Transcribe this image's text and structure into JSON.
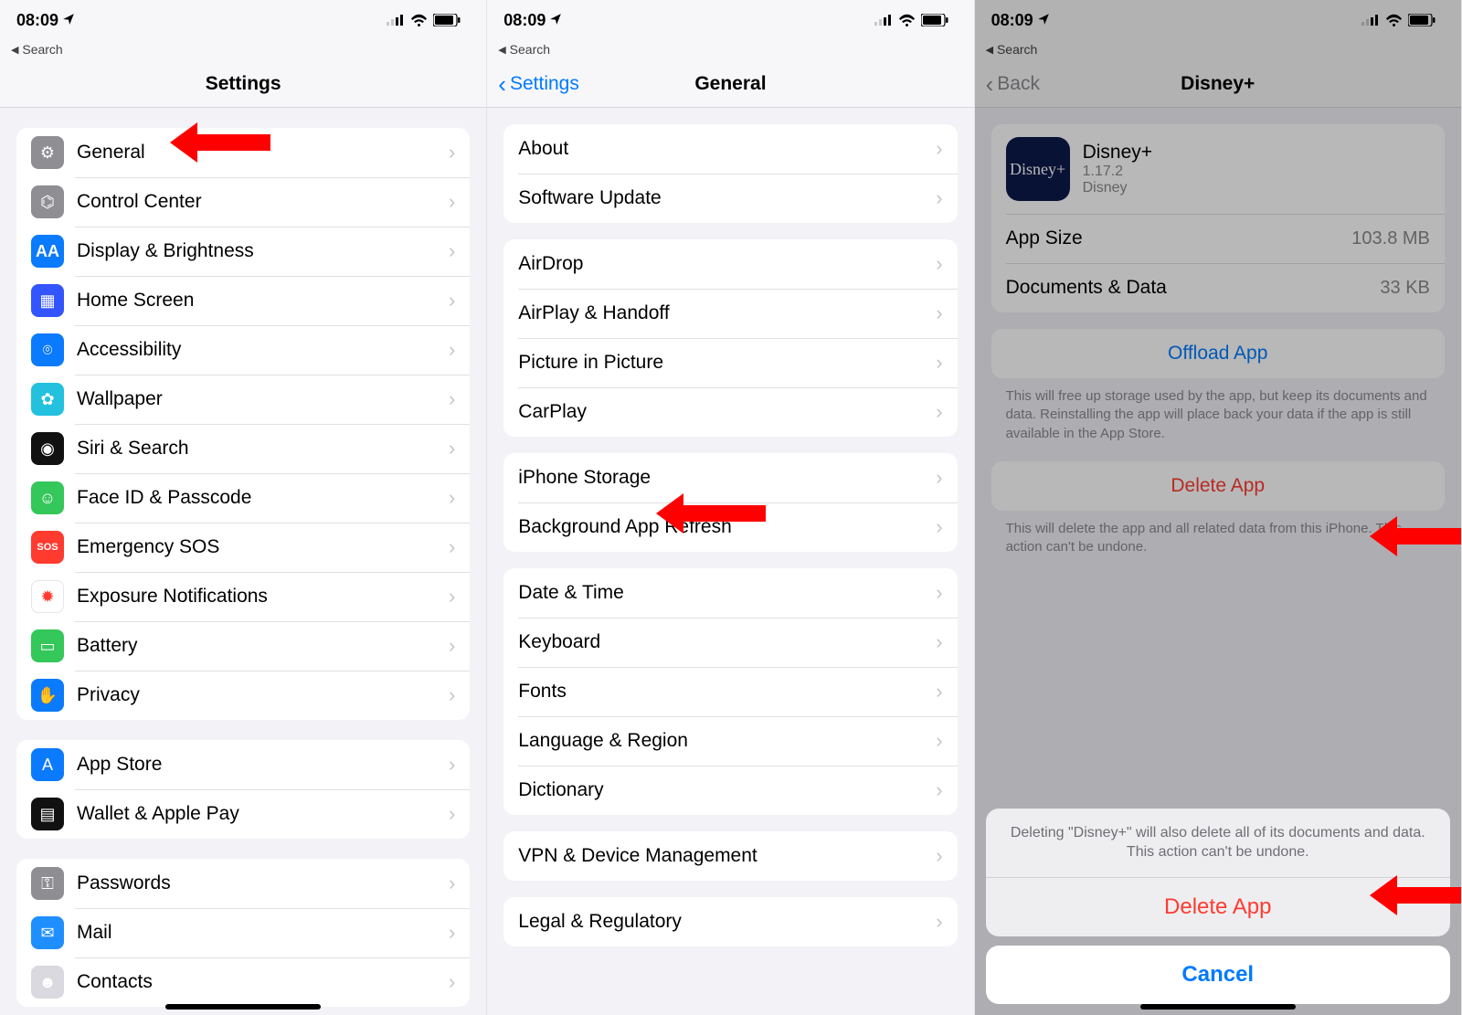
{
  "status": {
    "time": "08:09",
    "breadcrumb": "Search"
  },
  "screen1": {
    "title": "Settings",
    "groups": [
      [
        {
          "label": "General",
          "icon": "gear-icon",
          "bg": "#8e8e93"
        },
        {
          "label": "Control Center",
          "icon": "switches-icon",
          "bg": "#8e8e93"
        },
        {
          "label": "Display & Brightness",
          "icon": "text-size-icon",
          "bg": "#0a7aff"
        },
        {
          "label": "Home Screen",
          "icon": "grid-icon",
          "bg": "#3355ff"
        },
        {
          "label": "Accessibility",
          "icon": "person-icon",
          "bg": "#0a7aff"
        },
        {
          "label": "Wallpaper",
          "icon": "flower-icon",
          "bg": "#23c1de"
        },
        {
          "label": "Siri & Search",
          "icon": "siri-icon",
          "bg": "#111"
        },
        {
          "label": "Face ID & Passcode",
          "icon": "faceid-icon",
          "bg": "#34c759"
        },
        {
          "label": "Emergency SOS",
          "icon": "sos-icon",
          "bg": "#ff3b30"
        },
        {
          "label": "Exposure Notifications",
          "icon": "exposure-icon",
          "bg": "#fff",
          "fg": "#ff3b30",
          "border": true
        },
        {
          "label": "Battery",
          "icon": "battery-icon",
          "bg": "#34c759"
        },
        {
          "label": "Privacy",
          "icon": "hand-icon",
          "bg": "#0a7aff"
        }
      ],
      [
        {
          "label": "App Store",
          "icon": "appstore-icon",
          "bg": "#0a7aff"
        },
        {
          "label": "Wallet & Apple Pay",
          "icon": "wallet-icon",
          "bg": "#111"
        }
      ],
      [
        {
          "label": "Passwords",
          "icon": "key-icon",
          "bg": "#8e8e93"
        },
        {
          "label": "Mail",
          "icon": "mail-icon",
          "bg": "#1f8fff"
        },
        {
          "label": "Contacts",
          "icon": "contacts-icon",
          "bg": "#d9d9df"
        }
      ]
    ]
  },
  "screen2": {
    "back": "Settings",
    "title": "General",
    "groups": [
      [
        "About",
        "Software Update"
      ],
      [
        "AirDrop",
        "AirPlay & Handoff",
        "Picture in Picture",
        "CarPlay"
      ],
      [
        "iPhone Storage",
        "Background App Refresh"
      ],
      [
        "Date & Time",
        "Keyboard",
        "Fonts",
        "Language & Region",
        "Dictionary"
      ],
      [
        "VPN & Device Management"
      ],
      [
        "Legal & Regulatory"
      ]
    ]
  },
  "screen3": {
    "back": "Back",
    "title": "Disney+",
    "app": {
      "name": "Disney+",
      "version": "1.17.2",
      "vendor": "Disney"
    },
    "stats": [
      {
        "label": "App Size",
        "value": "103.8 MB"
      },
      {
        "label": "Documents & Data",
        "value": "33 KB"
      }
    ],
    "offload": {
      "label": "Offload App",
      "note": "This will free up storage used by the app, but keep its documents and data. Reinstalling the app will place back your data if the app is still available in the App Store."
    },
    "delete": {
      "label": "Delete App",
      "note": "This will delete the app and all related data from this iPhone. This action can't be undone."
    },
    "sheet": {
      "message": "Deleting \"Disney+\" will also delete all of its documents and data. This action can't be undone.",
      "action": "Delete App",
      "cancel": "Cancel"
    }
  },
  "icon_glyph": {
    "gear-icon": "⚙",
    "switches-icon": "⌬",
    "text-size-icon": "AA",
    "grid-icon": "▦",
    "person-icon": "⌾",
    "flower-icon": "✿",
    "siri-icon": "◉",
    "faceid-icon": "☺",
    "sos-icon": "SOS",
    "exposure-icon": "✹",
    "battery-icon": "▭",
    "hand-icon": "✋",
    "appstore-icon": "A",
    "wallet-icon": "▤",
    "key-icon": "⚿",
    "mail-icon": "✉",
    "contacts-icon": "☻"
  }
}
